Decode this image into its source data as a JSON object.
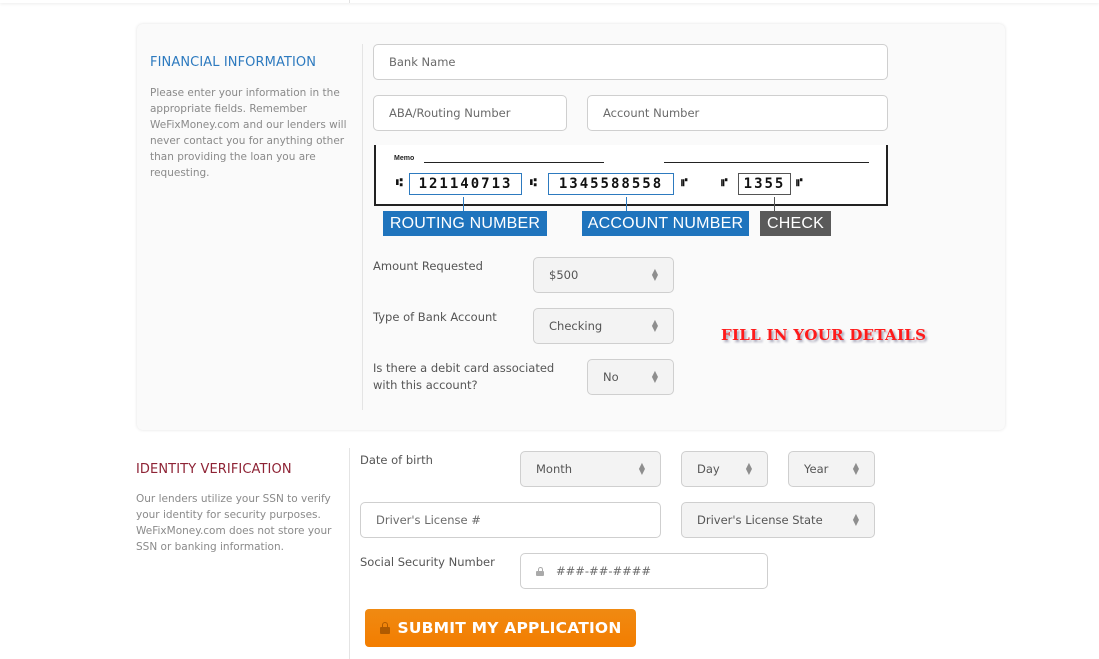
{
  "financial": {
    "title": "FINANCIAL INFORMATION",
    "description": "Please enter your information in the appropriate fields. Remember WeFixMoney.com and our lenders will never contact you for anything other than providing the loan you are requesting.",
    "bank_name_placeholder": "Bank Name",
    "routing_placeholder": "ABA/Routing Number",
    "account_placeholder": "Account Number",
    "check_image": {
      "memo": "Memo",
      "routing_digits": "121140713",
      "account_digits": "1345588558",
      "check_digits": "1355",
      "symbol_transit": "⑆",
      "symbol_onus": "⑈",
      "routing_label": "ROUTING NUMBER",
      "account_label": "ACCOUNT NUMBER",
      "check_label": "CHECK",
      "routing_color": "#1f74bd",
      "check_color": "#5a5a5a"
    },
    "amount_label": "Amount Requested",
    "amount_value": "$500",
    "account_type_label": "Type of Bank Account",
    "account_type_value": "Checking",
    "debit_label": "Is there a debit card associated with this account?",
    "debit_value": "No"
  },
  "promo_text": "FILL IN YOUR DETAILS",
  "identity": {
    "title": "IDENTITY VERIFICATION",
    "description": "Our lenders utilize your SSN to verify your identity for security purposes. WeFixMoney.com does not store your SSN or banking information.",
    "dob_label": "Date of birth",
    "month_value": "Month",
    "day_value": "Day",
    "year_value": "Year",
    "license_placeholder": "Driver's License #",
    "license_state_value": "Driver's License State",
    "ssn_label": "Social Security Number",
    "ssn_placeholder": "###-##-####"
  },
  "submit_label": "SUBMIT MY APPLICATION",
  "colors": {
    "financial_title": "#2d7abf",
    "identity_title": "#8e2335",
    "submit": "#f37d00",
    "promo": "#ff1a1a"
  }
}
